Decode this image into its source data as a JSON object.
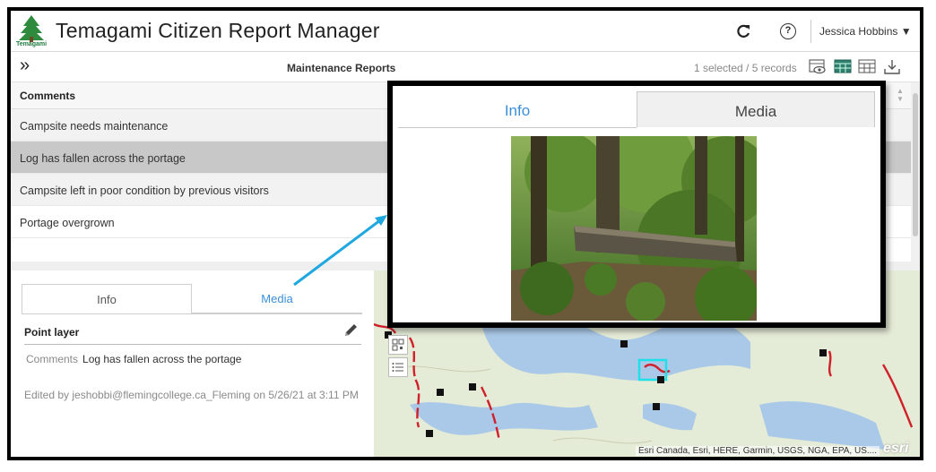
{
  "app": {
    "title": "Temagami Citizen Report Manager",
    "logo_caption": "Temagami",
    "user": "Jessica Hobbins ▼",
    "help_glyph": "?"
  },
  "toolbar": {
    "expand_glyph": "»",
    "layer_title": "Maintenance Reports",
    "record_count": "1 selected / 5 records"
  },
  "table": {
    "column": "Comments",
    "rows": [
      "Campsite needs maintenance",
      "Log has fallen across the portage",
      "Campsite left in poor condition by previous visitors",
      "Portage overgrown"
    ],
    "selected_index": 1
  },
  "panel": {
    "tabs": [
      "Info",
      "Media"
    ],
    "layer_label": "Point layer",
    "comment_key": "Comments",
    "comment_value": "Log has fallen across the portage",
    "edited": "Edited by jeshobbi@flemingcollege.ca_Fleming on 5/26/21 at 3:11 PM"
  },
  "map": {
    "attribution": "Esri Canada, Esri, HERE, Garmin, USGS, NGA, EPA, US....",
    "esri_logo": "esri"
  },
  "popup": {
    "tabs": [
      "Info",
      "Media"
    ]
  },
  "colors": {
    "accent": "#3b8fd9",
    "selected_row": "#c8c8c8",
    "arrow": "#1fa8e0",
    "trail": "#d0202a",
    "highlight": "#1ee0e8",
    "water": "#a9c8e8"
  }
}
